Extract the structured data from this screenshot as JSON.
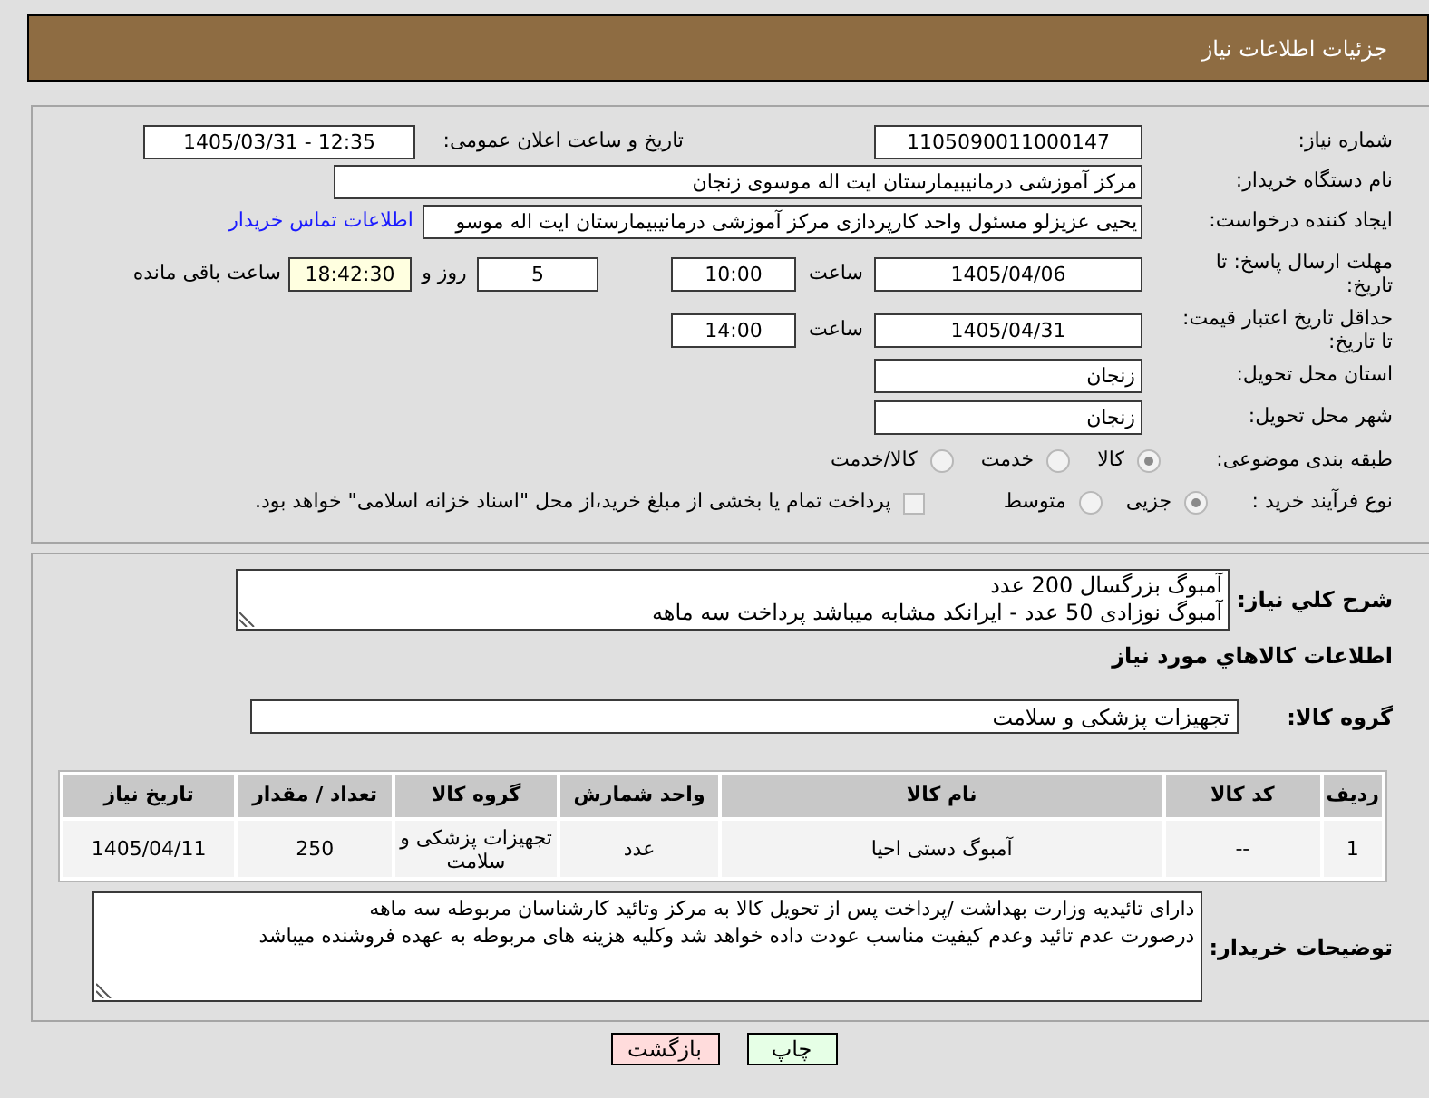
{
  "title": "جزئیات اطلاعات نیاز",
  "details": {
    "need_number": {
      "label": "شماره نیاز:",
      "value": "1105090011000147"
    },
    "announcement": {
      "label": "تاریخ و ساعت اعلان عمومی:",
      "value": "1405/03/31 - 12:35"
    },
    "buyer_org": {
      "label": "نام دستگاه خریدار:",
      "value": "مرکز آموزشی درمانیبیمارستان ایت اله موسوی زنجان"
    },
    "requester": {
      "label": "ایجاد کننده درخواست:",
      "value": "یحیی عزیزلو مسئول واحد کارپردازی مرکز آموزشی درمانیبیمارستان ایت اله موسو",
      "contact_link": "اطلاعات تماس خریدار"
    },
    "response_deadline": {
      "label": "مهلت ارسال پاسخ: تا تاریخ:",
      "date": "1405/04/06",
      "time_label": "ساعت",
      "time": "10:00",
      "days": "5",
      "days_label": "روز و",
      "remaining": "18:42:30",
      "remaining_label": "ساعت باقی مانده"
    },
    "price_validity": {
      "label": "حداقل تاریخ اعتبار قیمت: تا تاریخ:",
      "date": "1405/04/31",
      "time_label": "ساعت",
      "time": "14:00"
    },
    "delivery_province": {
      "label": "استان محل تحویل:",
      "value": "زنجان"
    },
    "delivery_city": {
      "label": "شهر محل تحویل:",
      "value": "زنجان"
    },
    "category": {
      "label": "طبقه بندی موضوعی:",
      "options": [
        {
          "label": "کالا",
          "selected": true,
          "disabled": true
        },
        {
          "label": "خدمت",
          "selected": false,
          "disabled": true
        },
        {
          "label": "کالا/خدمت",
          "selected": false,
          "disabled": true
        }
      ]
    },
    "purchase_type": {
      "label": "نوع فرآیند خرید :",
      "options": [
        {
          "label": "جزیی",
          "selected": true,
          "disabled": true
        },
        {
          "label": "متوسط",
          "selected": false,
          "disabled": true
        }
      ],
      "treasury_payment": {
        "label": "پرداخت تمام یا بخشی از مبلغ خرید،از محل \"اسناد خزانه اسلامی\" خواهد بود.",
        "checked": false,
        "disabled": true
      }
    }
  },
  "requirements": {
    "description": {
      "label": "شرح کلي نیاز:",
      "value": "آمبوگ بزرگسال 200 عدد\nآمبوگ نوزادی 50 عدد - ایرانکد مشابه میباشد پرداخت سه ماهه"
    },
    "goods_title": "اطلاعات كالاهاي مورد نیاز",
    "goods_group": {
      "label": "گروه کالا:",
      "value": "تجهیزات پزشکی و سلامت"
    },
    "table": {
      "columns": [
        "ردیف",
        "کد کالا",
        "نام کالا",
        "واحد شمارش",
        "گروه کالا",
        "تعداد / مقدار",
        "تاریخ نیاز"
      ],
      "rows": [
        [
          "1",
          "--",
          "آمبوگ دستی احیا",
          "عدد",
          "تجهیزات پزشکی و سلامت",
          "250",
          "1405/04/11"
        ]
      ]
    },
    "buyer_notes": {
      "label": "توضیحات خریدار:",
      "value": "دارای تائیدیه وزارت بهداشت /پرداخت پس از تحویل کالا به مرکز وتائید کارشناسان مربوطه سه ماهه\nدرصورت عدم تائید وعدم کیفیت مناسب عودت داده خواهد شد وکلیه هزینه های مربوطه به عهده فروشنده میباشد"
    }
  },
  "buttons": [
    {
      "kind": "print",
      "label": "چاپ"
    },
    {
      "kind": "back",
      "label": "بازگشت"
    }
  ]
}
